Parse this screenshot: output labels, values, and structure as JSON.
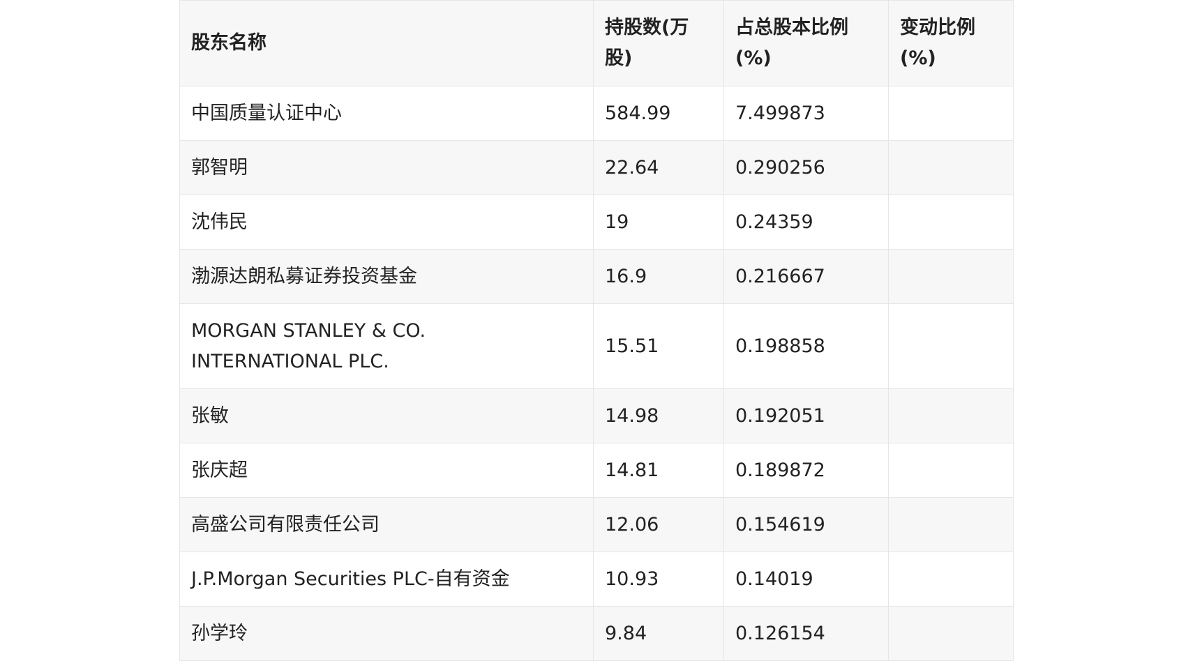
{
  "table": {
    "headers": [
      "股东名称",
      "持股数(万股)",
      "占总股本比例(%)",
      "变动比例(%)"
    ],
    "rows": [
      [
        "中国质量认证中心",
        "584.99",
        "7.499873",
        ""
      ],
      [
        "郭智明",
        "22.64",
        "0.290256",
        ""
      ],
      [
        "沈伟民",
        "19",
        "0.24359",
        ""
      ],
      [
        "渤源达朗私募证券投资基金",
        "16.9",
        "0.216667",
        ""
      ],
      [
        "MORGAN STANLEY & CO. INTERNATIONAL PLC.",
        "15.51",
        "0.198858",
        ""
      ],
      [
        "张敏",
        "14.98",
        "0.192051",
        ""
      ],
      [
        "张庆超",
        "14.81",
        "0.189872",
        ""
      ],
      [
        "高盛公司有限责任公司",
        "12.06",
        "0.154619",
        ""
      ],
      [
        "J.P.Morgan Securities PLC-自有资金",
        "10.93",
        "0.14019",
        ""
      ],
      [
        "孙学玲",
        "9.84",
        "0.126154",
        ""
      ]
    ]
  }
}
